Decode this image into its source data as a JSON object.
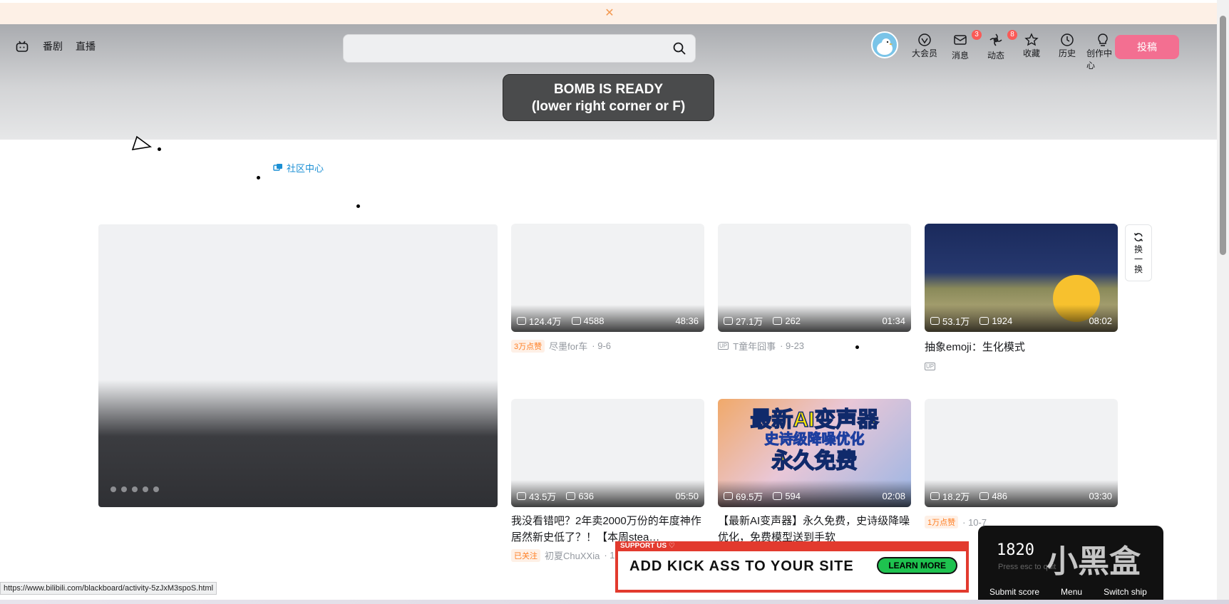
{
  "notice": {
    "close_icon": "close-icon"
  },
  "nav_left": {
    "home_icon": "bilibili-tv-icon",
    "items": [
      "番剧",
      "直播"
    ]
  },
  "search": {
    "placeholder": "",
    "icon": "search-icon"
  },
  "nav_right": {
    "items": [
      {
        "label": "大会员",
        "icon": "vip-icon",
        "badge": ""
      },
      {
        "label": "消息",
        "icon": "message-icon",
        "badge": "3"
      },
      {
        "label": "动态",
        "icon": "feed-icon",
        "badge": "8"
      },
      {
        "label": "收藏",
        "icon": "star-icon",
        "badge": ""
      },
      {
        "label": "历史",
        "icon": "clock-icon",
        "badge": ""
      },
      {
        "label": "创作中心",
        "icon": "bulb-icon",
        "badge": ""
      }
    ],
    "upload_label": "投稿"
  },
  "bomb": {
    "line1": "BOMB IS READY",
    "line2": "(lower right corner or F)"
  },
  "community": {
    "label": "社区中心"
  },
  "refresh": {
    "label_chars": [
      "换",
      "一",
      "换"
    ]
  },
  "videos": [
    {
      "views": "124.4万",
      "danmaku": "4588",
      "duration": "48:36",
      "title": "",
      "tag": "3万点赞",
      "author": "尽墨for车",
      "date": "· 9-6"
    },
    {
      "views": "27.1万",
      "danmaku": "262",
      "duration": "01:34",
      "title": "",
      "tag": "",
      "author": "T童年囧事",
      "date": "· 9-23"
    },
    {
      "views": "53.1万",
      "danmaku": "1924",
      "duration": "08:02",
      "title": "抽象emoji：生化模式",
      "tag": "",
      "author": "",
      "date": ""
    },
    {
      "views": "43.5万",
      "danmaku": "636",
      "duration": "05:50",
      "title": "我没看错吧？2年卖2000万份的年度神作居然新史低了？！【本周stea…",
      "tag": "已关注",
      "author": "初夏ChuXXia",
      "date": "· 1"
    },
    {
      "views": "69.5万",
      "danmaku": "594",
      "duration": "02:08",
      "title": "【最新AI变声器】永久免费，史诗级降噪优化，免费模型送到手软",
      "tag": "",
      "author": "",
      "date": ""
    },
    {
      "views": "18.2万",
      "danmaku": "486",
      "duration": "03:30",
      "title": "",
      "tag": "1万点赞",
      "author": "",
      "date": "· 10-7"
    }
  ],
  "ai_thumb_text": [
    "最新AI变声器",
    "史诗级降噪优化",
    "永久免费"
  ],
  "status_url": "https://www.bilibili.com/blackboard/activity-5zJxM3spoS.html",
  "ad": {
    "support": "SUPPORT US ♡",
    "text": "ADD KICK ASS TO YOUR SITE",
    "button": "LEARN MORE"
  },
  "score_panel": {
    "score": "1820",
    "hint": "Press esc to quit",
    "buttons": [
      "Submit score",
      "Menu",
      "Switch ship"
    ]
  },
  "watermark": "小黑盒"
}
